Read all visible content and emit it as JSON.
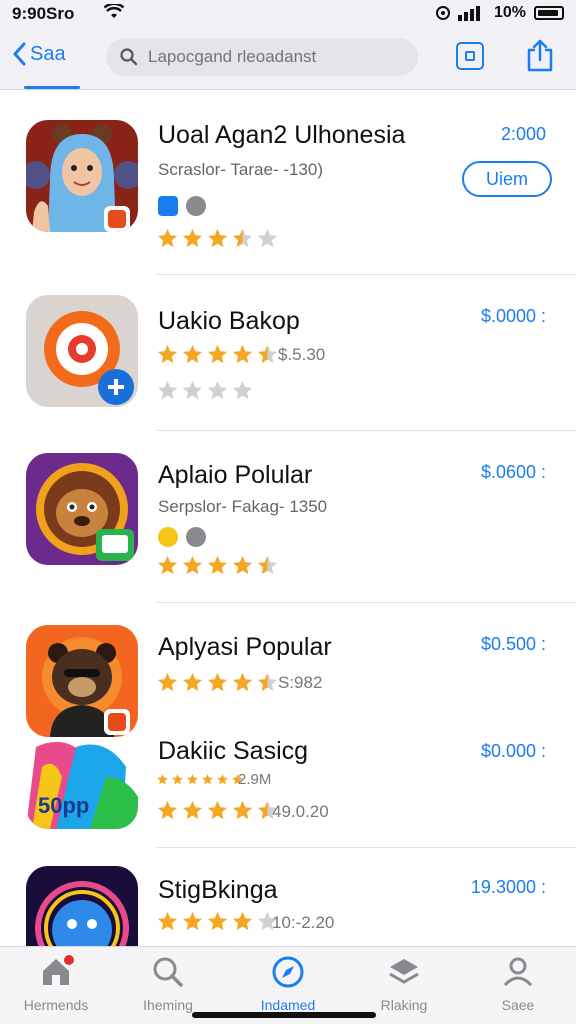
{
  "status_bar": {
    "time": "9:90Sro",
    "battery": "10%"
  },
  "nav": {
    "back_label": "Saa",
    "search_placeholder": "Lapocgand rleoadanst"
  },
  "apps": [
    {
      "name": "Uoal Agan2 Ulhonesia",
      "subtitle": "Scraslor- Tarae- -130)",
      "price": "2:000",
      "button_label": "Uiem",
      "rating": 3.5
    },
    {
      "name": "Uakio Bakop",
      "rating_text": "$.5.30",
      "price": "$.0000 :",
      "rating": 4.5
    },
    {
      "name": "Aplaio Polular",
      "subtitle": "Serpslor- Fakag- 1350",
      "price": "$.0600 :",
      "rating": 4.5
    },
    {
      "name": "Aplyasi Popular",
      "rating_text": "S:982",
      "price": "$0.500 :",
      "rating": 4.5
    },
    {
      "name": "Dakiic Sasicg",
      "sub_rating_text": "2.9M",
      "rating_text": "49.0.20",
      "price": "$0.000 :",
      "rating": 4.5,
      "icon_label": "50pp"
    },
    {
      "name": "StigBkinga",
      "rating_text": "10:-2.20",
      "price": "19.3000 :",
      "rating": 4
    }
  ],
  "tabs": [
    {
      "label": "Hermends",
      "icon": "home-icon"
    },
    {
      "label": "Iheming",
      "icon": "search-icon"
    },
    {
      "label": "Indamed",
      "icon": "compass-icon",
      "active": true
    },
    {
      "label": "Rlaking",
      "icon": "layers-icon"
    },
    {
      "label": "Saee",
      "icon": "profile-icon"
    }
  ],
  "colors": {
    "accent": "#1a7df0",
    "star": "#f5a623",
    "star_empty": "#cfcfd4"
  }
}
